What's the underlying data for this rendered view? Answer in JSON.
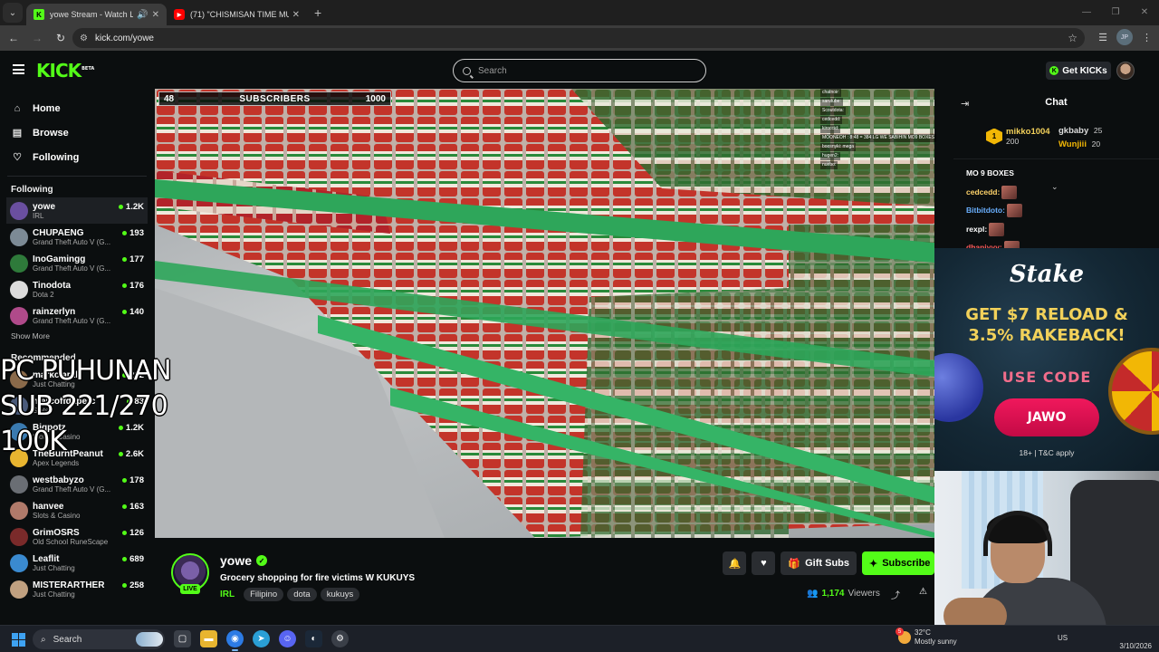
{
  "browser": {
    "tabs": [
      {
        "title": "yowe Stream - Watch Live on",
        "active": true
      },
      {
        "title": "(71) \"CHISMISAN TIME MUNA\"",
        "active": false
      }
    ],
    "new_tab": "+",
    "url": "kick.com/yowe",
    "profile": "JP"
  },
  "header": {
    "logo": "KICK",
    "logo_badge": "BETA",
    "search_placeholder": "Search",
    "get_kicks": "Get KICKs"
  },
  "sidebar": {
    "nav": [
      {
        "label": "Home",
        "icon": "home-icon"
      },
      {
        "label": "Browse",
        "icon": "browse-icon"
      },
      {
        "label": "Following",
        "icon": "heart-icon"
      }
    ],
    "following_heading": "Following",
    "following": [
      {
        "name": "yowe",
        "category": "IRL",
        "viewers": "1.2K",
        "color": "#6a4fa0"
      },
      {
        "name": "CHUPAENG",
        "category": "Grand Theft Auto V (G...",
        "viewers": "193",
        "color": "#7c8a95"
      },
      {
        "name": "InoGamingg",
        "category": "Grand Theft Auto V (G...",
        "viewers": "177",
        "color": "#2e7a3a"
      },
      {
        "name": "Tinodota",
        "category": "Dota 2",
        "viewers": "176",
        "color": "#dcdcdc"
      },
      {
        "name": "rainzerlyn",
        "category": "Grand Theft Auto V (G...",
        "viewers": "140",
        "color": "#b04a8a"
      }
    ],
    "show_more": "Show More",
    "recommended_heading": "Recommended",
    "recommended": [
      {
        "name": "markclarkk",
        "category": "Just Chatting",
        "viewers": "222",
        "color": "#8a6a4a"
      },
      {
        "name": "mercoffdaperc",
        "category": "Slots",
        "viewers": "83",
        "color": "#4a5a7a"
      },
      {
        "name": "Bigpotz",
        "category": "Slots & Casino",
        "viewers": "1.2K",
        "color": "#3a7ab0"
      },
      {
        "name": "TheBurntPeanut",
        "category": "Apex Legends",
        "viewers": "2.6K",
        "color": "#e8b530"
      },
      {
        "name": "westbabyzo",
        "category": "Grand Theft Auto V (G...",
        "viewers": "178",
        "color": "#6a6e74"
      },
      {
        "name": "hanvee",
        "category": "Slots & Casino",
        "viewers": "163",
        "color": "#b07a6a"
      },
      {
        "name": "GrimOSRS",
        "category": "Old School RuneScape",
        "viewers": "126",
        "color": "#7a2a2a"
      },
      {
        "name": "Leaflit",
        "category": "Just Chatting",
        "viewers": "689",
        "color": "#3a8ad0"
      },
      {
        "name": "MISTERARTHER",
        "category": "Just Chatting",
        "viewers": "258",
        "color": "#c0a080"
      }
    ]
  },
  "video": {
    "sub_goal": {
      "current": "48",
      "label": "SUBSCRIBERS",
      "target": "1000"
    },
    "overlay_lines": [
      "PC PUHUNAN",
      "SUB 221/270",
      "100K"
    ],
    "mini_chat": [
      "chatnoir:",
      "sarutube:",
      "Scoutdota:",
      "cedcedd:",
      "kiroccid:",
      "MOONEOH : 8:48 = 384 LG WE SABIHIN MO9 BOXES",
      "boosnyki: mega",
      "hugen2:",
      "nuebo:"
    ]
  },
  "stream": {
    "username": "yowe",
    "live_label": "LIVE",
    "title": "Grocery shopping for fire victims W KUKUYS",
    "category": "IRL",
    "tags": [
      "Filipino",
      "dota",
      "kukuys"
    ],
    "gift_subs": "Gift Subs",
    "subscribe": "Subscribe",
    "viewer_count": "1,174",
    "viewers_label": "Viewers"
  },
  "chat": {
    "title": "Chat",
    "top_gifters": [
      {
        "rank": "1",
        "name": "mikko1004",
        "count": "200"
      },
      {
        "name": "gkbaby",
        "count": "25"
      },
      {
        "name": "Wunjiii",
        "count": "20"
      }
    ],
    "messages": [
      {
        "user": "MO 9 BOXES",
        "color": "#ffffff"
      },
      {
        "user": "cedcedd:",
        "color": "#ffd36a"
      },
      {
        "user": "Bitbitdoto:",
        "color": "#6ab0ff"
      },
      {
        "user": "rexpl:",
        "color": "#ffffff"
      },
      {
        "user": "dhaniyyy:",
        "color": "#ff5a5a"
      }
    ]
  },
  "ad": {
    "brand": "Stake",
    "offer_line1": "GET $7 RELOAD &",
    "offer_line2": "3.5% RAKEBACK!",
    "use_code": "USE CODE",
    "code": "JAWO",
    "terms": "18+ | T&C apply"
  },
  "taskbar": {
    "search_label": "Search",
    "weather_temp": "32°C",
    "weather_desc": "Mostly sunny",
    "weather_badge": "5",
    "tray_lang": "US",
    "clock_date": "3/10/2026"
  }
}
